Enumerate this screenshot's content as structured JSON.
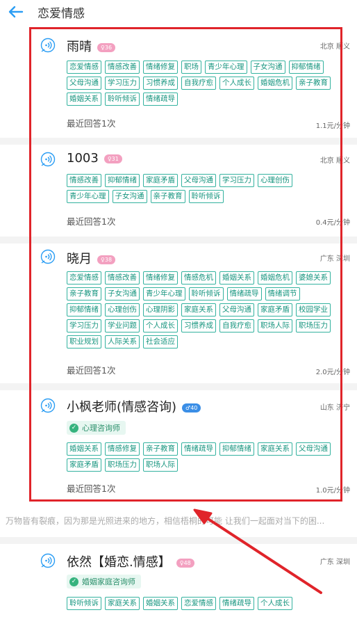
{
  "header": {
    "title": "恋爱情感"
  },
  "counselors": [
    {
      "name": "雨晴",
      "badge": "♀36",
      "location": "北京 顺义",
      "tags": [
        "恋爱情感",
        "情感改善",
        "情绪修复",
        "职场",
        "青少年心理",
        "子女沟通",
        "抑郁情绪",
        "父母沟通",
        "学习压力",
        "习惯养成",
        "自我疗愈",
        "个人成长",
        "婚姻危机",
        "亲子教育",
        "婚姻关系",
        "聆听倾诉",
        "情绪疏导"
      ],
      "recent": "最近回答1次",
      "price": "1.1元/分钟"
    },
    {
      "name": "1003",
      "badge": "♀31",
      "location": "北京 顺义",
      "tags": [
        "情感改善",
        "抑郁情绪",
        "家庭矛盾",
        "父母沟通",
        "学习压力",
        "心理创伤",
        "青少年心理",
        "子女沟通",
        "亲子教育",
        "聆听倾诉"
      ],
      "recent": "最近回答1次",
      "price": "0.4元/分钟"
    },
    {
      "name": "晓月",
      "badge": "♀38",
      "location": "广东 深圳",
      "tags": [
        "恋爱情感",
        "情感改善",
        "情绪修复",
        "情感危机",
        "婚姻关系",
        "婚姻危机",
        "婆媳关系",
        "亲子教育",
        "子女沟通",
        "青少年心理",
        "聆听倾诉",
        "情绪疏导",
        "情绪调节",
        "抑郁情绪",
        "心理创伤",
        "心理阴影",
        "家庭关系",
        "父母沟通",
        "家庭矛盾",
        "校园学业",
        "学习压力",
        "学业问题",
        "个人成长",
        "习惯养成",
        "自我疗愈",
        "职场人际",
        "职场压力",
        "职业规划",
        "人际关系",
        "社会适应"
      ],
      "recent": "最近回答1次",
      "price": "2.0元/分钟"
    },
    {
      "name": "小枫老师(情感咨询)",
      "badge": "♂40",
      "location": "山东 济宁",
      "cert": "心理咨询师",
      "tags": [
        "婚姻关系",
        "情感修复",
        "亲子教育",
        "情绪疏导",
        "抑郁情绪",
        "家庭关系",
        "父母沟通",
        "家庭矛盾",
        "职场压力",
        "职场人际"
      ],
      "recent": "最近回答1次",
      "price": "1.0元/分钟"
    },
    {
      "name": "依然【婚恋.情感】",
      "badge": "♀48",
      "location": "广东 深圳",
      "cert": "婚姻家庭咨询师",
      "tags": [
        "聆听倾诉",
        "家庭关系",
        "婚姻关系",
        "恋爱情感",
        "情绪疏导",
        "个人成长"
      ]
    }
  ],
  "marquee": "万物皆有裂痕，因为那是光照进来的地方，相信梧桐的可能 让我们一起面对当下的困...",
  "colors": {
    "accent": "#2a9df4",
    "tag": "#33b29f",
    "highlight": "#e0242a",
    "badge_female": "#f3a0c0",
    "badge_male": "#3a8ee6"
  }
}
